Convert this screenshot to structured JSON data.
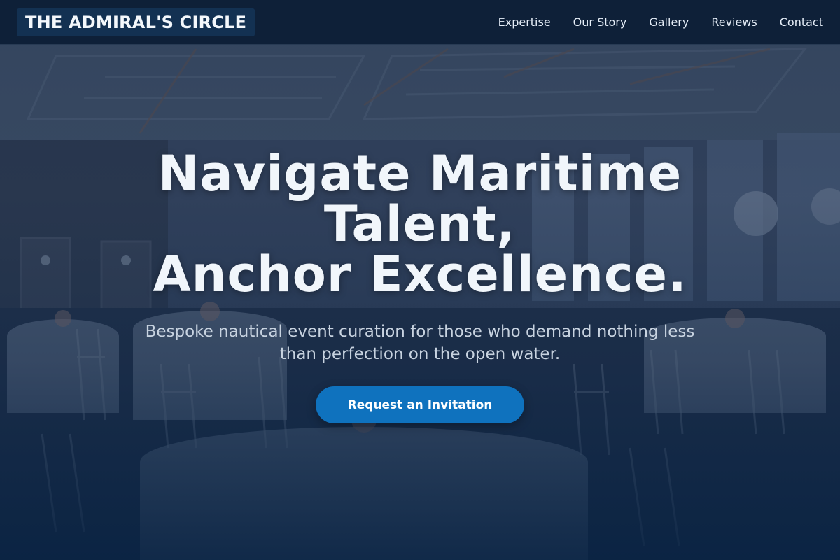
{
  "brand": {
    "name": "THE ADMIRAL'S CIRCLE"
  },
  "nav": {
    "links": [
      {
        "label": "Expertise"
      },
      {
        "label": "Our Story"
      },
      {
        "label": "Gallery"
      },
      {
        "label": "Reviews"
      },
      {
        "label": "Contact"
      }
    ]
  },
  "hero": {
    "title_lines": [
      "Navigate Maritime",
      "Talent,",
      "Anchor Excellence."
    ],
    "subtitle": "Bespoke nautical event curation for those who demand nothing less than perfection on the open water.",
    "cta_label": "Request an Invitation",
    "background_image": "banquet-hall-photo"
  },
  "colors": {
    "nav_background": "#0d1f36",
    "brand_background": "#133152",
    "accent": "#0f72be",
    "title_text": "#f1f6fb",
    "subtitle_text": "#c8d3e0"
  }
}
